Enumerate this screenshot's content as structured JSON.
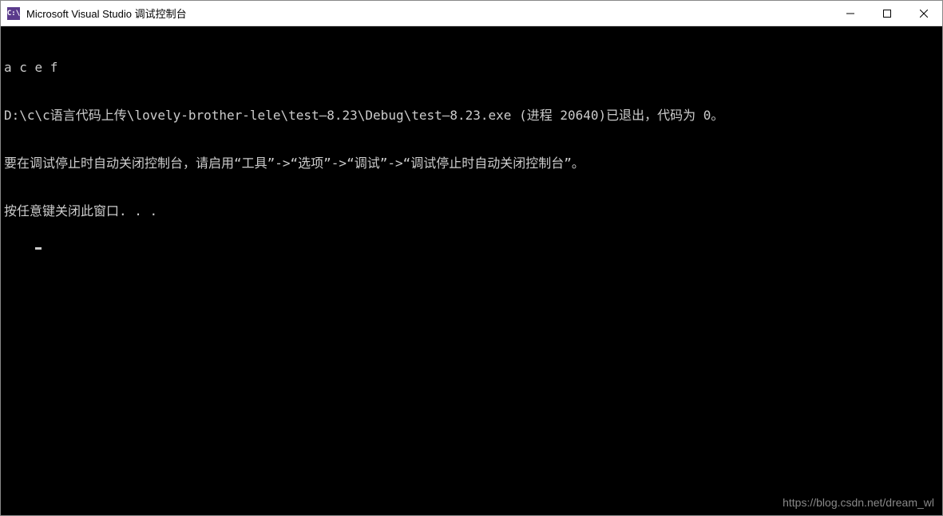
{
  "titlebar": {
    "icon_text": "C:\\",
    "title": "Microsoft Visual Studio 调试控制台"
  },
  "console": {
    "lines": [
      "a c e f",
      "D:\\c\\c语言代码上传\\lovely-brother-lele\\test—8.23\\Debug\\test—8.23.exe (进程 20640)已退出，代码为 0。",
      "要在调试停止时自动关闭控制台，请启用“工具”->“选项”->“调试”->“调试停止时自动关闭控制台”。",
      "按任意键关闭此窗口. . ."
    ]
  },
  "watermark": "https://blog.csdn.net/dream_wl"
}
